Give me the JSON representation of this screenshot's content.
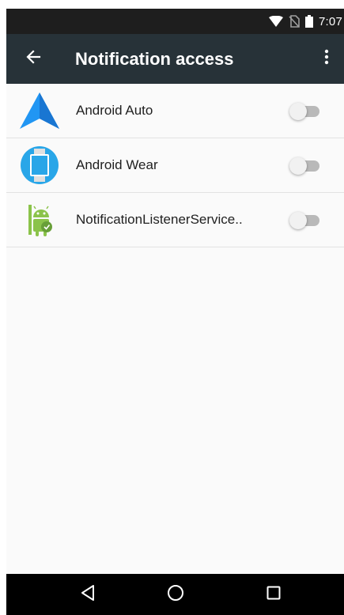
{
  "status_bar": {
    "time": "7:07",
    "icons": [
      "wifi-icon",
      "no-sim-icon",
      "battery-icon"
    ]
  },
  "app_bar": {
    "back_icon": "arrow-back-icon",
    "title": "Notification access",
    "overflow_icon": "more-vert-icon"
  },
  "apps": [
    {
      "label": "Android Auto",
      "icon": "android-auto-icon",
      "enabled": false
    },
    {
      "label": "Android Wear",
      "icon": "android-wear-icon",
      "enabled": false
    },
    {
      "label": "NotificationListenerService..",
      "icon": "android-robot-icon",
      "enabled": false
    }
  ],
  "nav_bar": {
    "buttons": [
      "nav-back-icon",
      "nav-home-icon",
      "nav-recents-icon"
    ]
  },
  "colors": {
    "status_bar": "#1e1e1e",
    "app_bar": "#273238",
    "background": "#fafafa",
    "android_auto_blue": "#2196f3",
    "android_wear_blue": "#29a6e8",
    "android_green": "#8bc34a"
  }
}
